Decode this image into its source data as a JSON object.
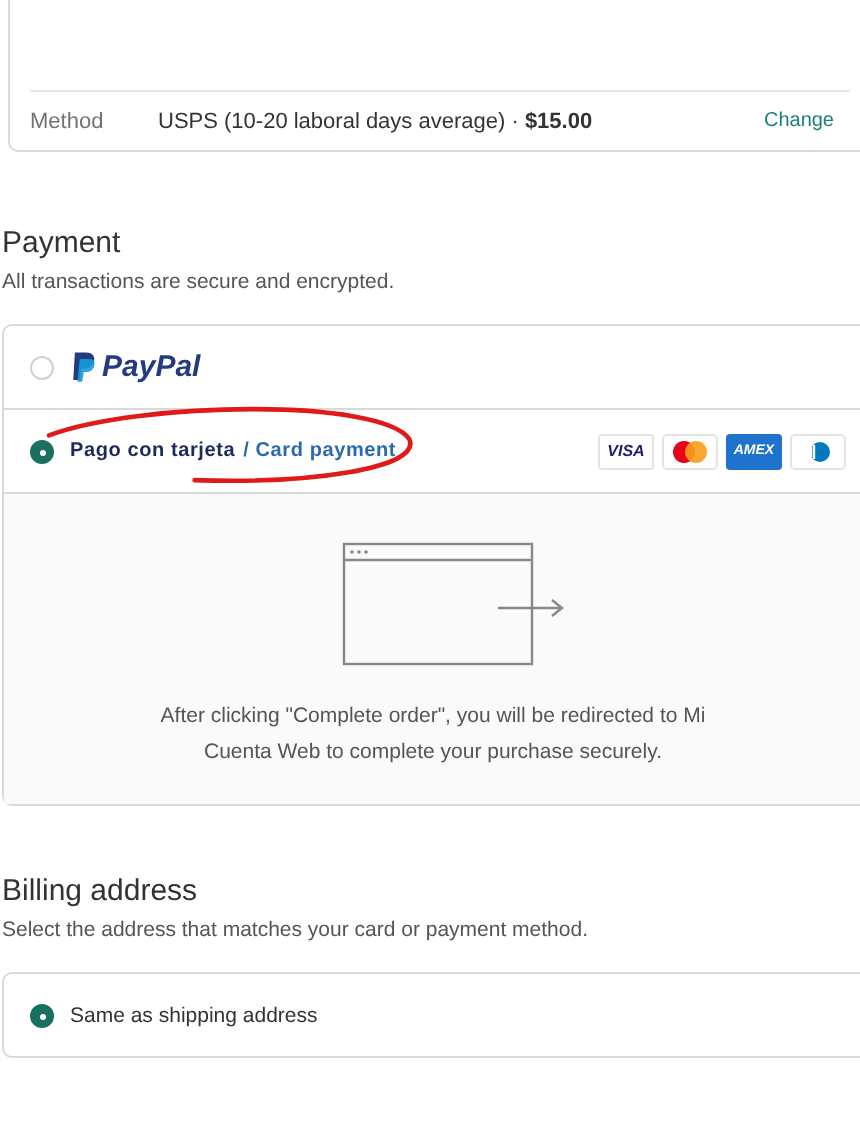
{
  "shipping": {
    "method_label": "Method",
    "method_value": "USPS (10-20 laboral days average) · **$15.00**",
    "change_link": "Change"
  },
  "payment": {
    "title": "Payment",
    "subtitle": "All transactions are secure and encrypted.",
    "options": [
      {
        "kind": "paypal",
        "selected": false,
        "logo": "PayPal"
      },
      {
        "kind": "card",
        "selected": true,
        "label": "Pago con tarjeta",
        "label_translation": "/ Card payment",
        "brands": [
          {
            "kind": "visa",
            "text": "VISA"
          },
          {
            "kind": "mastercard"
          },
          {
            "kind": "amex",
            "text": "AMEX"
          },
          {
            "kind": "diners"
          }
        ]
      }
    ],
    "redirect_note": "After clicking \"Complete order\", you will be redirected to Mi Cuenta Web to complete your purchase securely."
  },
  "billing": {
    "title": "Billing address",
    "subtitle": "Select the address that matches your card or payment method.",
    "options": [
      {
        "label": "Same as shipping address",
        "selected": true
      }
    ]
  }
}
